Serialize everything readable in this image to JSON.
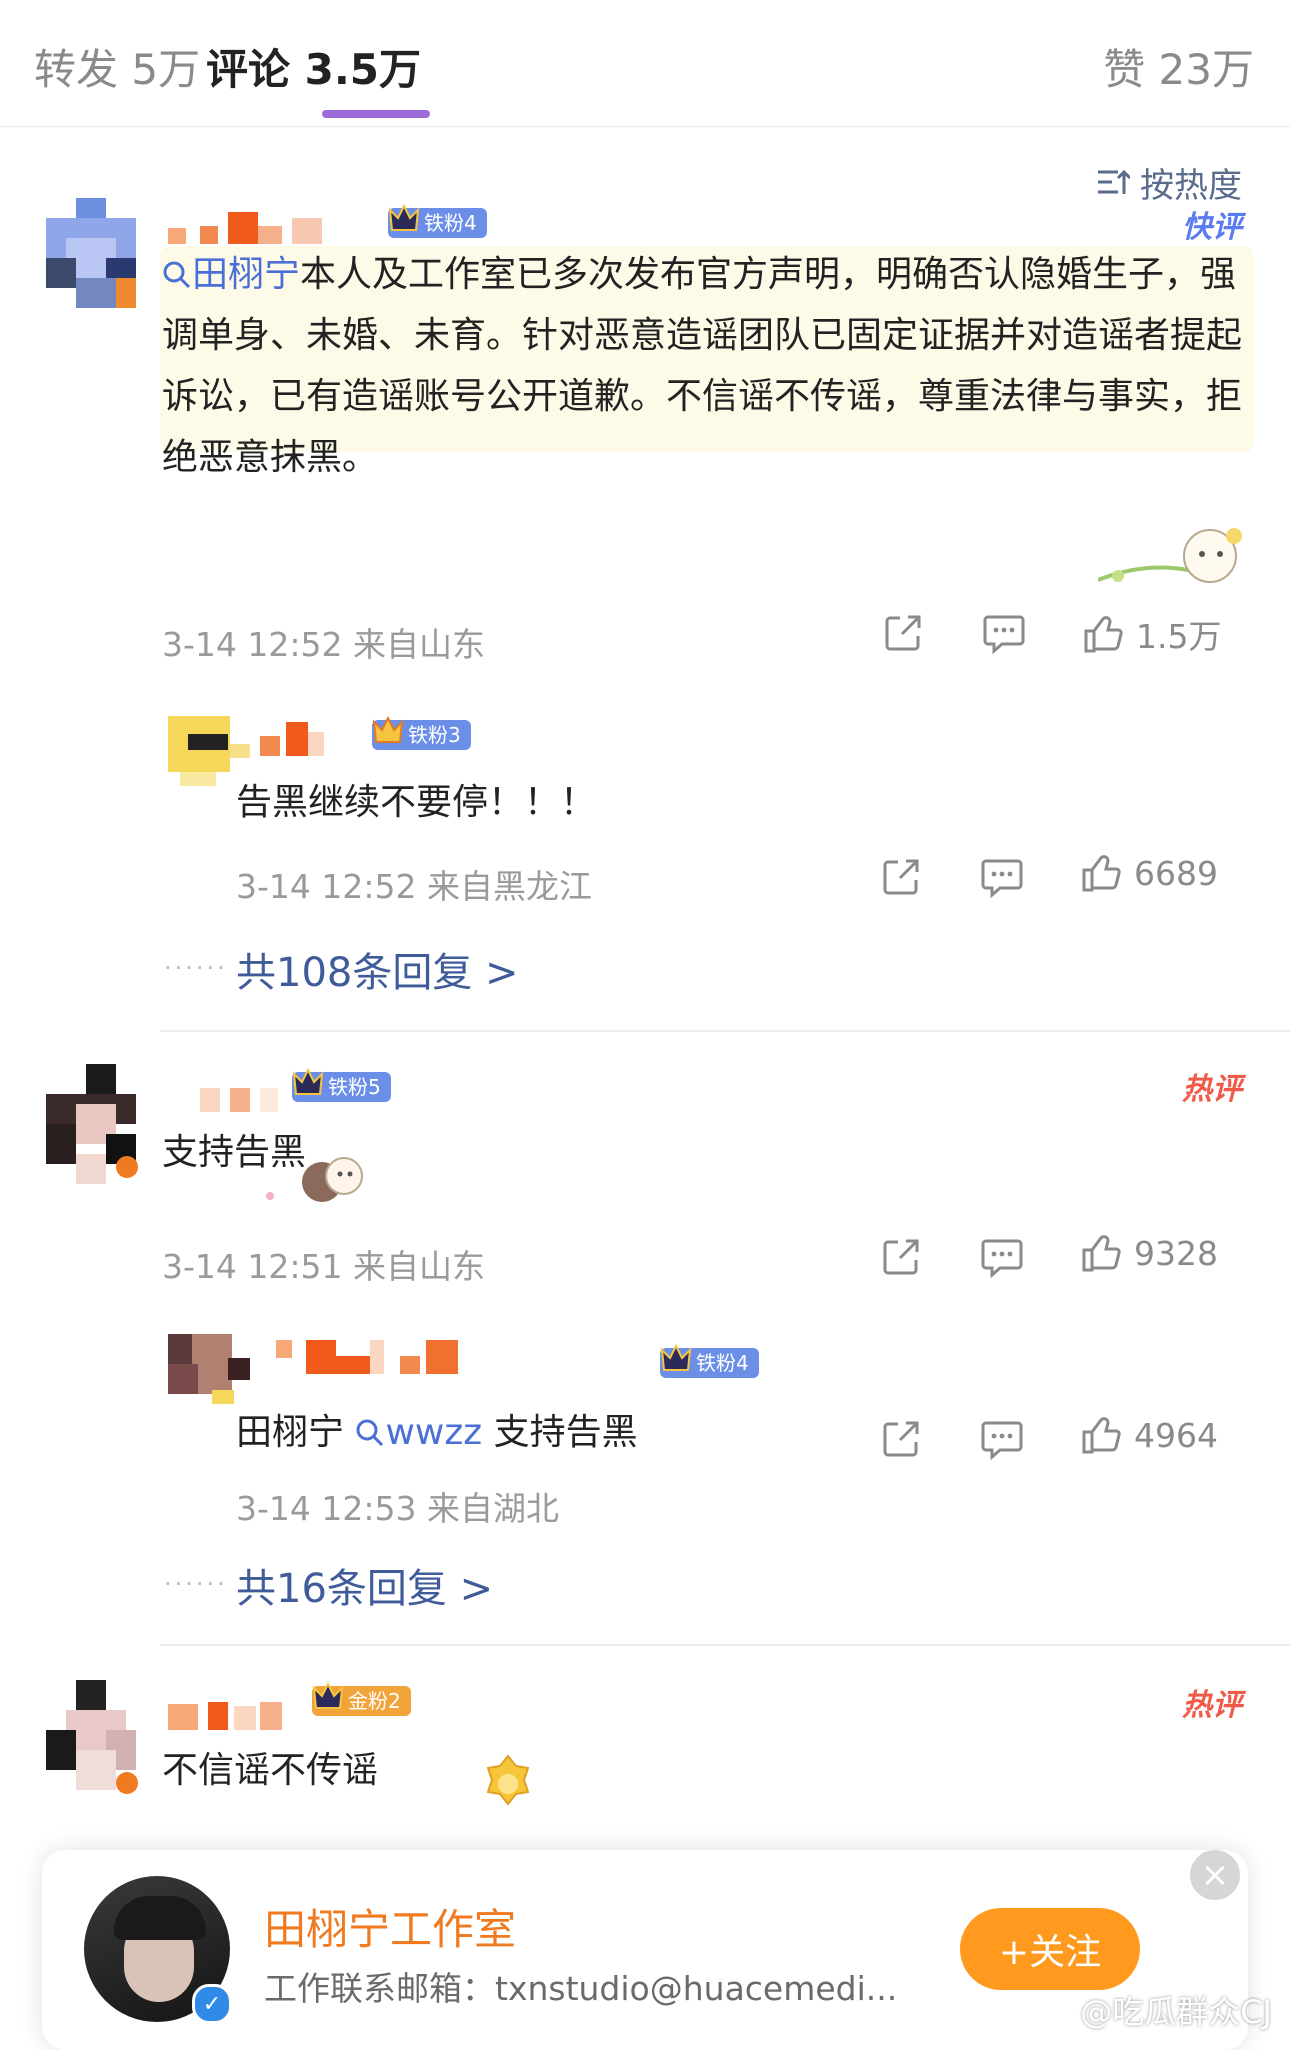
{
  "tabs": [
    {
      "label": "转发 5万"
    },
    {
      "label": "评论 3.5万"
    },
    {
      "label": "赞 23万"
    }
  ],
  "sort": {
    "label": "按热度",
    "icon": "sort-icon"
  },
  "comments": [
    {
      "badge": "铁粉4",
      "tag": "快评",
      "text_prefix": "田栩宁",
      "text": "本人及工作室已多次发布官方声明，明确否认隐婚生子，强调单身、未婚、未育。针对恶意造谣团队已固定证据并对造谣者提起诉讼，已有造谣账号公开道歉。不信谣不传谣，尊重法律与事实，拒绝恶意抹黑。",
      "time": "3-14 12:52 来自山东",
      "likes": "1.5万",
      "reply": {
        "badge": "铁粉3",
        "text": "告黑继续不要停！！！",
        "time": "3-14 12:52 来自黑龙江",
        "likes": "6689"
      },
      "more": "共108条回复 >"
    },
    {
      "badge": "铁粉5",
      "tag": "热评",
      "text": "支持告黑",
      "time": "3-14 12:51 来自山东",
      "likes": "9328",
      "reply": {
        "badge": "铁粉4",
        "text_prefix": "田栩宁 ",
        "text_link": "wwzz",
        "text": " 支持告黑",
        "time": "3-14 12:53 来自湖北",
        "likes": "4964"
      },
      "more": "共16条回复 >"
    },
    {
      "badge": "金粉2",
      "tag": "热评",
      "text": "不信谣不传谣"
    }
  ],
  "card": {
    "name": "田栩宁工作室",
    "desc": "工作联系邮箱：txnstudio@huacemedi...",
    "follow": "+关注"
  },
  "watermark": "@吃瓜群众CJ",
  "colors": {
    "accent": "#9b6bd8",
    "link": "#4a6fd6",
    "follow": "#ff9a1e",
    "hot": "#f05a4a",
    "fast": "#5b7cf0"
  }
}
